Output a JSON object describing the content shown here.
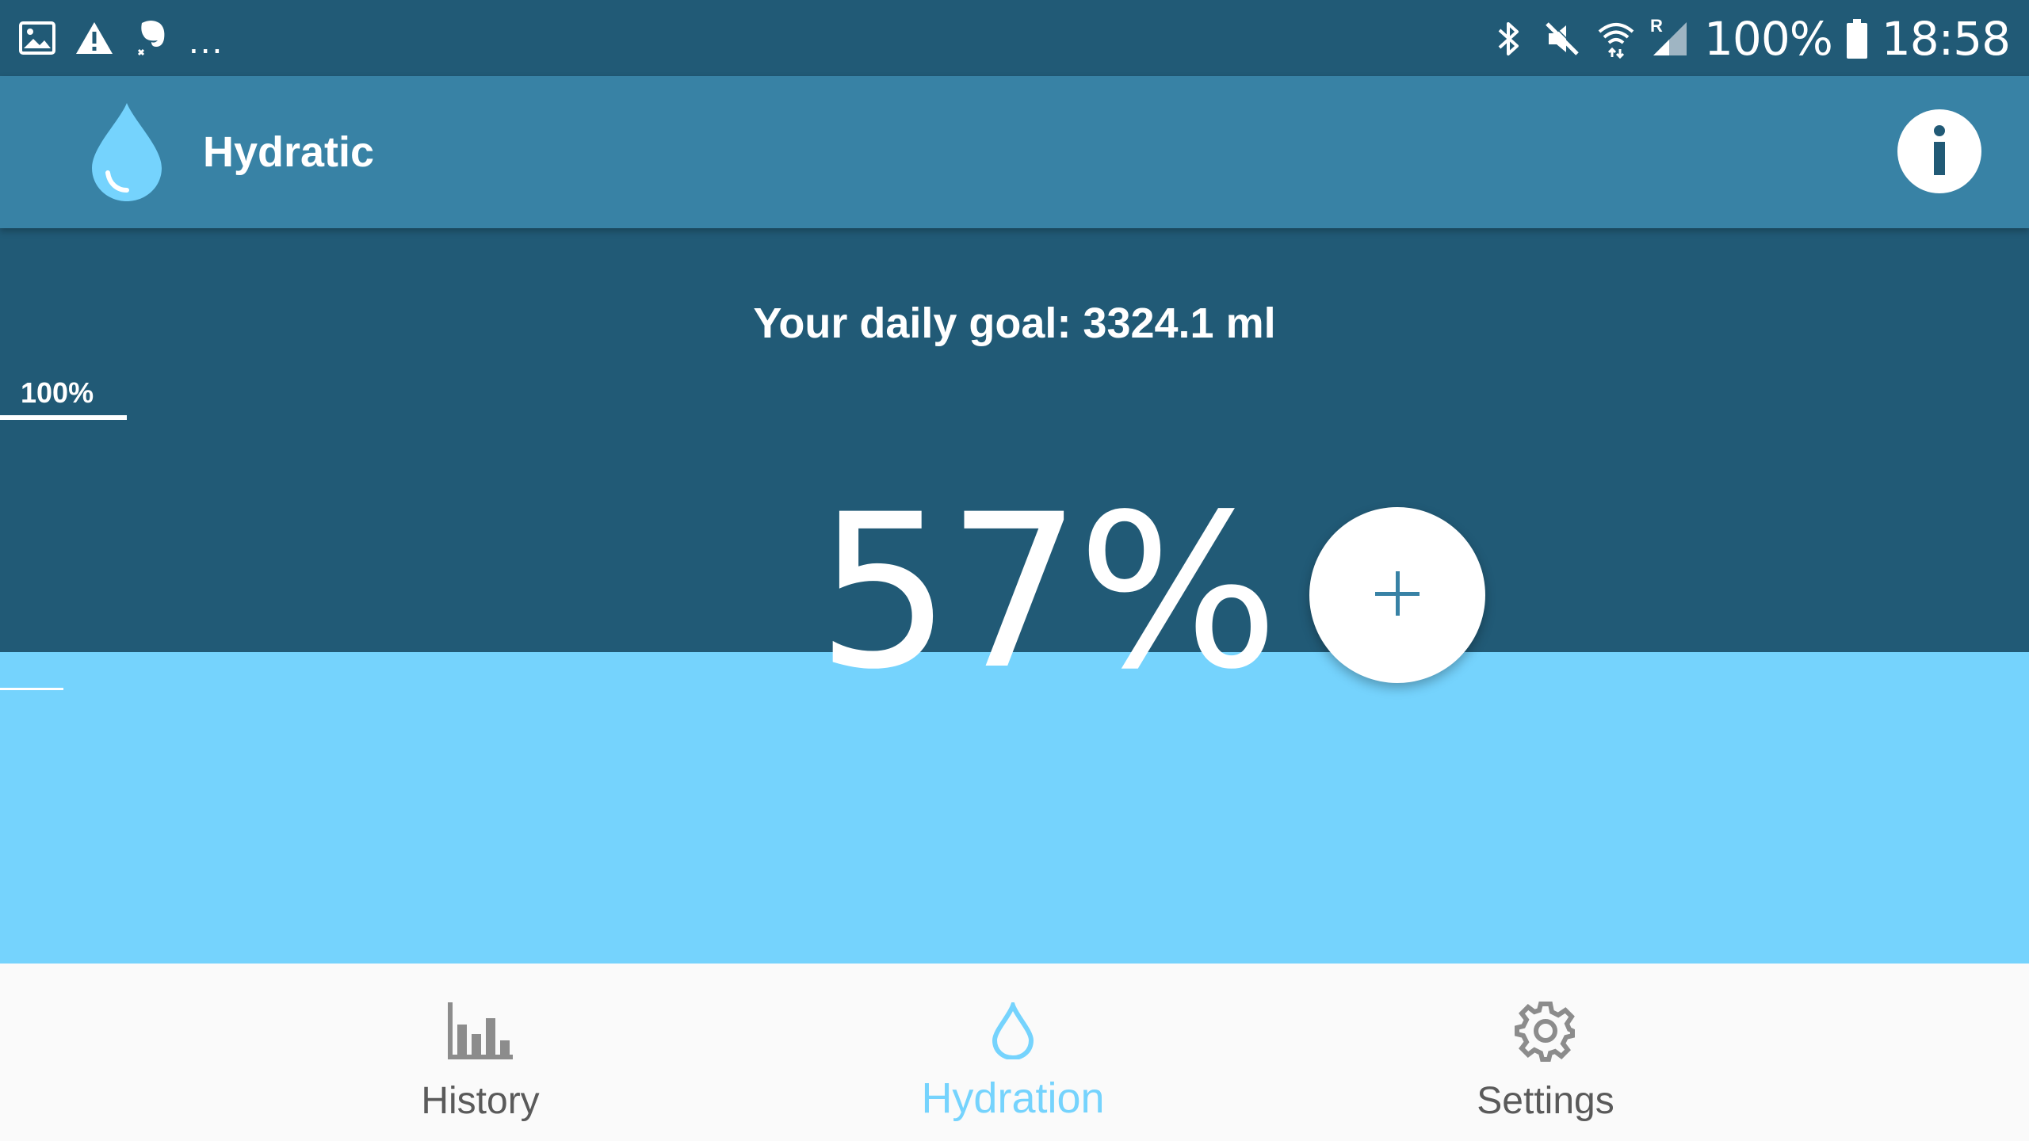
{
  "status_bar": {
    "left_icons": [
      "gallery-icon",
      "warning-icon",
      "evernote-icon"
    ],
    "overflow": "...",
    "right_icons": [
      "bluetooth-icon",
      "mute-icon",
      "wifi-icon",
      "signal-icon"
    ],
    "roaming": "R",
    "battery_level": "100%",
    "time": "18:58"
  },
  "app_bar": {
    "title": "Hydratic",
    "logo_icon": "water-drop-icon",
    "info_icon": "info-icon"
  },
  "main": {
    "daily_goal": "Your daily goal: 3324.1 ml",
    "goal_marker_label": "100%",
    "progress_label": "57%",
    "progress_fraction": 0.57,
    "add_icon": "plus-icon"
  },
  "bottom_nav": {
    "items": [
      {
        "label": "History",
        "icon": "bar-chart-icon",
        "active": false
      },
      {
        "label": "Hydration",
        "icon": "water-drop-icon",
        "active": true
      },
      {
        "label": "Settings",
        "icon": "gear-icon",
        "active": false
      }
    ]
  },
  "colors": {
    "status_bar": "#215a76",
    "app_bar": "#3882a5",
    "background": "#215a76",
    "water": "#75d3fd",
    "nav_background": "#fafafa",
    "nav_inactive": "#5a5a5a",
    "nav_active": "#75d3fd",
    "accent": "#3882a5"
  }
}
